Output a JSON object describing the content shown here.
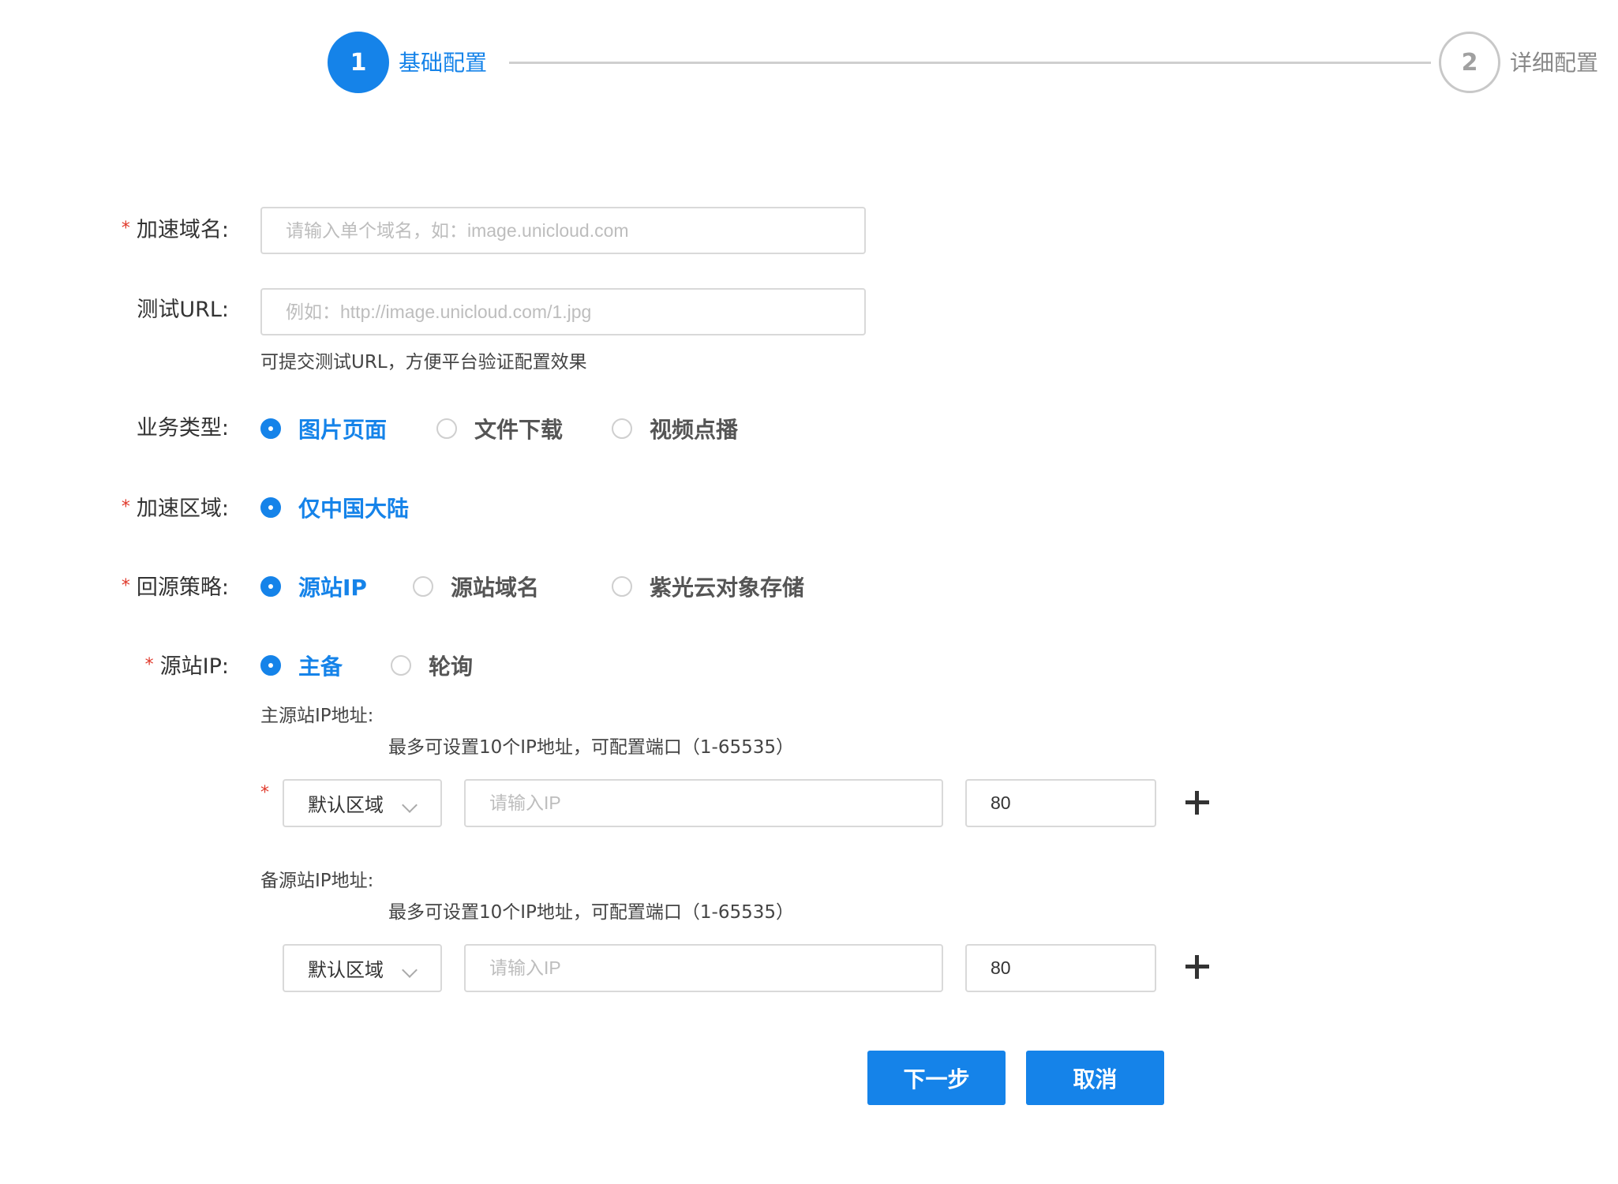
{
  "steps": [
    {
      "number": "1",
      "title": "基础配置"
    },
    {
      "number": "2",
      "title": "详细配置"
    }
  ],
  "form": {
    "domain": {
      "label": "加速域名:",
      "placeholder": "请输入单个域名，如：image.unicloud.com"
    },
    "test_url": {
      "label": "测试URL:",
      "placeholder": "例如：http://image.unicloud.com/1.jpg",
      "hint": "可提交测试URL，方便平台验证配置效果"
    },
    "business_type": {
      "label": "业务类型:",
      "options": [
        "图片页面",
        "文件下载",
        "视频点播"
      ],
      "selected": "图片页面"
    },
    "region": {
      "label": "加速区域:",
      "options": [
        "仅中国大陆"
      ],
      "selected": "仅中国大陆"
    },
    "origin_policy": {
      "label": "回源策略:",
      "options": [
        "源站IP",
        "源站域名",
        "紫光云对象存储"
      ],
      "selected": "源站IP"
    },
    "origin_ip": {
      "label": "源站IP:",
      "options": [
        "主备",
        "轮询"
      ],
      "selected": "主备"
    },
    "primary": {
      "title": "主源站IP地址:",
      "hint": "最多可设置10个IP地址，可配置端口（1-65535）",
      "region": "默认区域",
      "ip_placeholder": "请输入IP",
      "port": "80"
    },
    "backup": {
      "title": "备源站IP地址:",
      "hint": "最多可设置10个IP地址，可配置端口（1-65535）",
      "region": "默认区域",
      "ip_placeholder": "请输入IP",
      "port": "80"
    }
  },
  "buttons": {
    "next": "下一步",
    "cancel": "取消"
  },
  "required_mark": "*",
  "colors": {
    "accent": "#1583e9",
    "required": "#e0392b"
  }
}
